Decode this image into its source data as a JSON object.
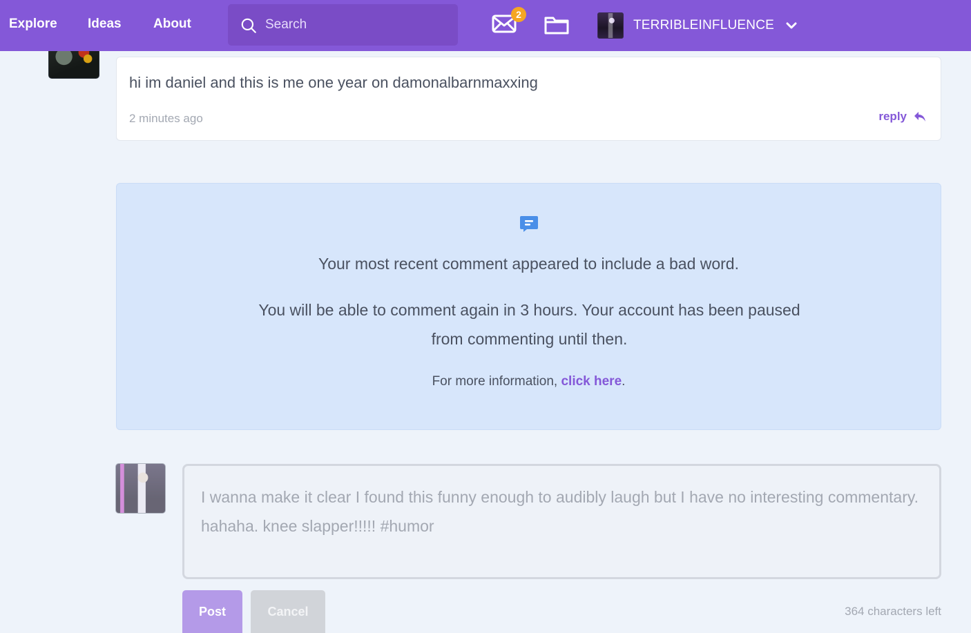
{
  "nav": {
    "links": [
      {
        "label": "Explore"
      },
      {
        "label": "Ideas"
      },
      {
        "label": "About"
      }
    ],
    "search": {
      "placeholder": "Search"
    },
    "notifications": {
      "count": "2"
    },
    "user": {
      "name": "TERRIBLEINFLUENCE"
    }
  },
  "comment": {
    "text": "hi im daniel and this is me one year on damonalbarnmaxxing",
    "time": "2 minutes ago",
    "reply_label": "reply"
  },
  "notice": {
    "line1": "Your most recent comment appeared to include a bad word.",
    "line2": "You will be able to comment again in 3 hours. Your account has been paused from commenting until then.",
    "info_prefix": "For more information, ",
    "info_link": "click here",
    "info_suffix": "."
  },
  "composer": {
    "draft": "I wanna make it clear I found this funny enough to audibly laugh but I have no interesting commentary. hahaha. knee slapper!!!!! #humor",
    "post_label": "Post",
    "cancel_label": "Cancel",
    "chars_left": "364 characters left"
  },
  "colors": {
    "nav_bg": "#8458d8",
    "accent": "#8458d8",
    "notice_bg": "#d7e6fb",
    "badge": "#f5a623",
    "notice_icon": "#4a8fe8"
  },
  "icons": {
    "search": "search-icon",
    "mail": "envelope-icon",
    "folder": "folder-icon",
    "dropdown": "chevron-down-icon",
    "reply": "reply-arrow-icon",
    "notice": "comment-icon"
  }
}
